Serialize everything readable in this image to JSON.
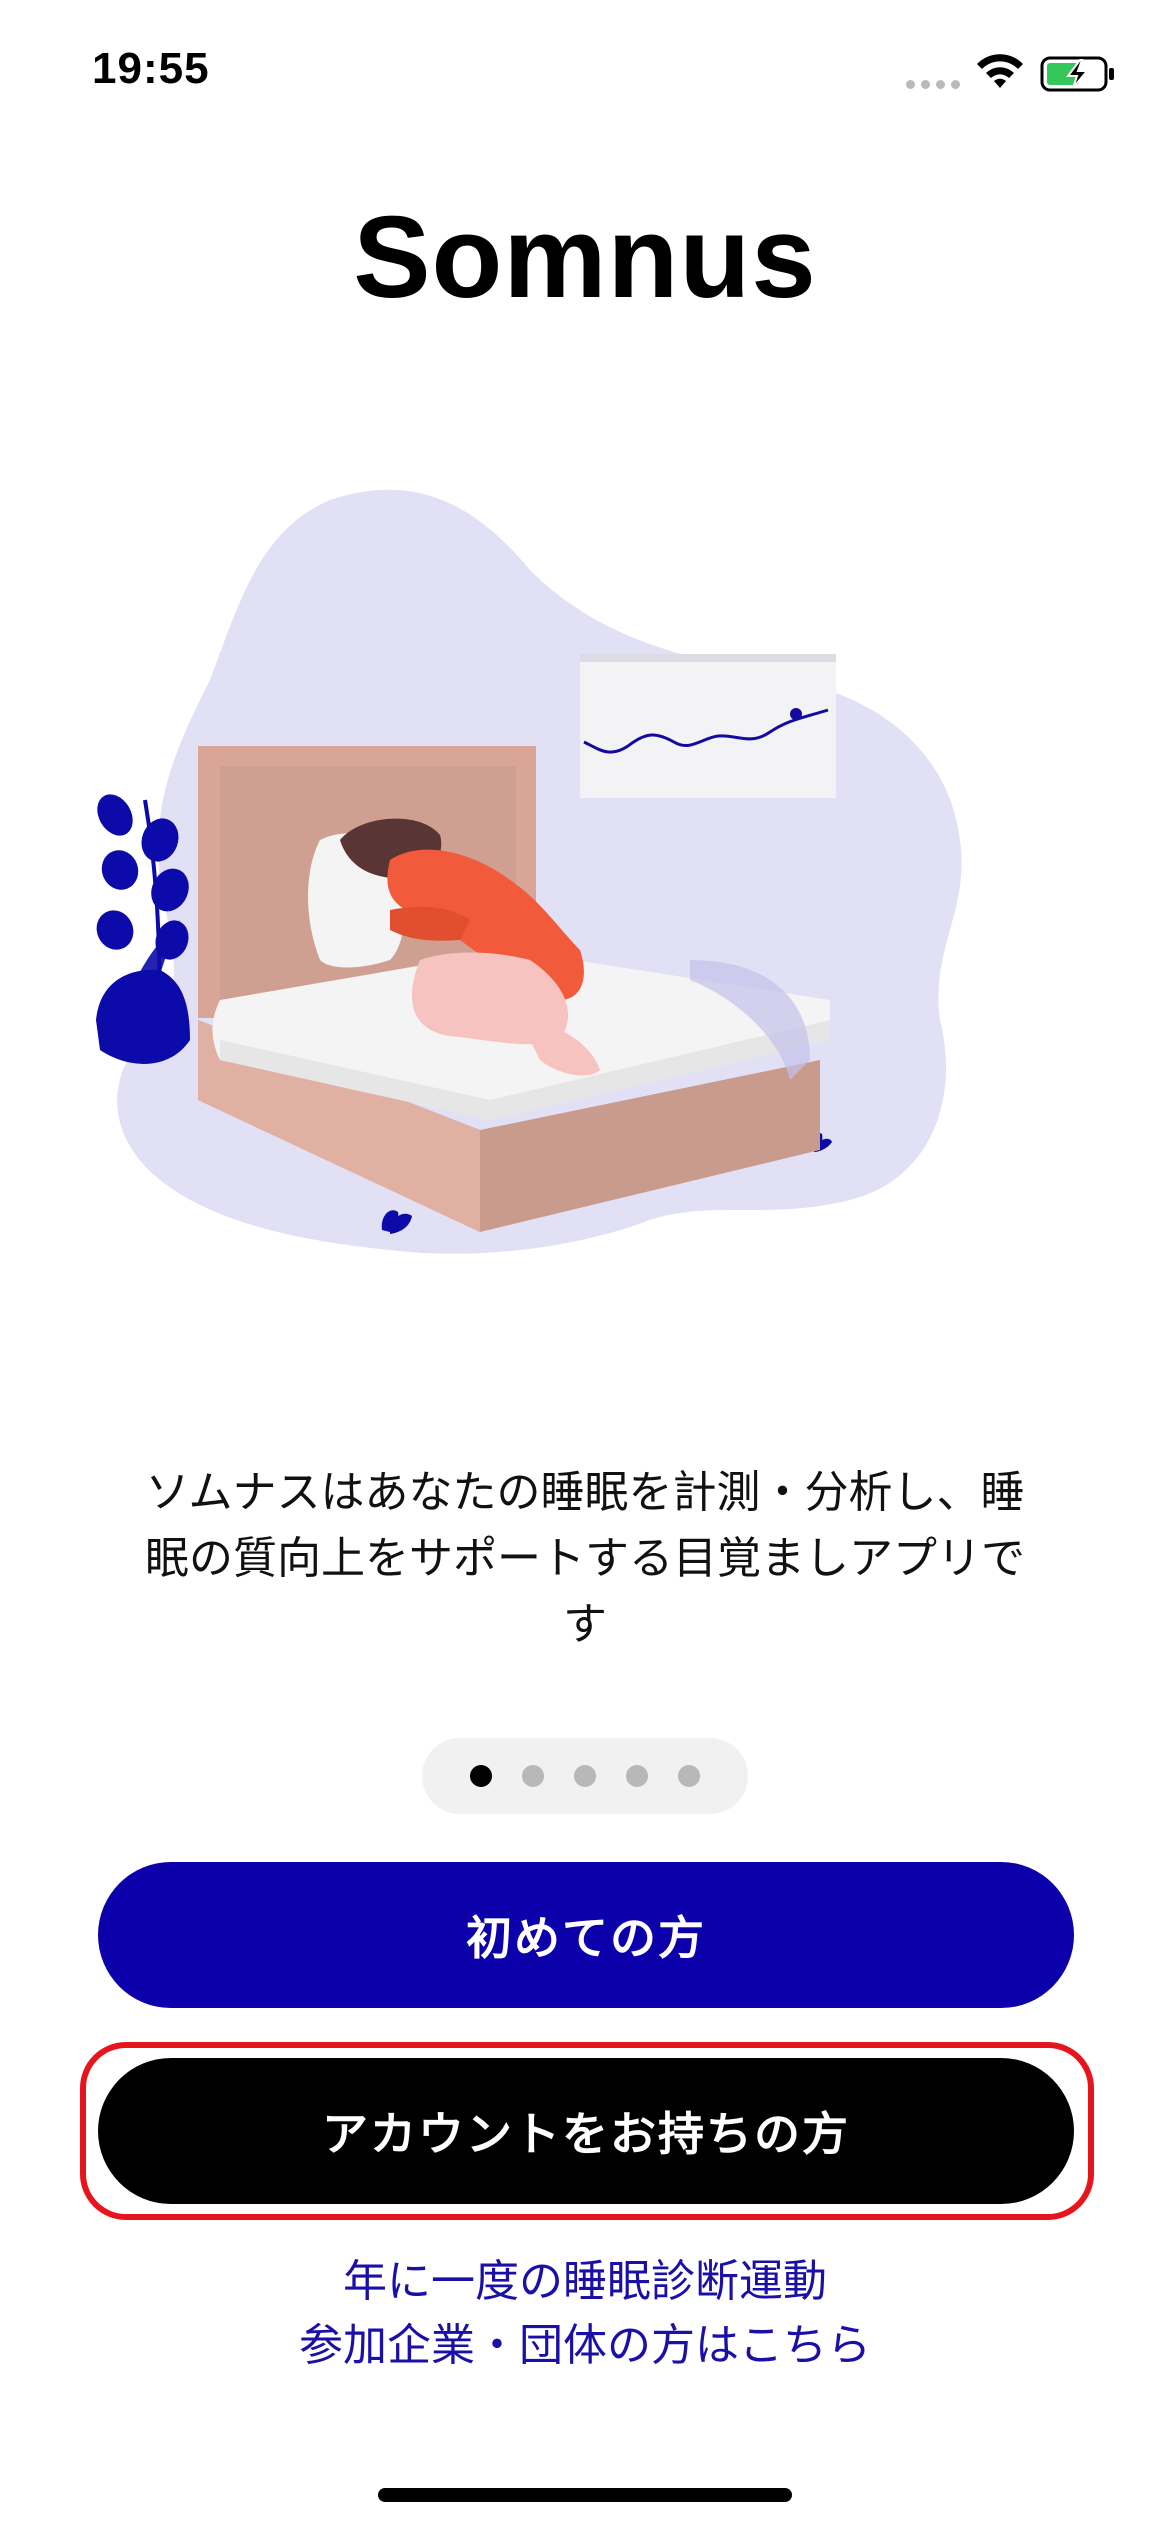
{
  "status_bar": {
    "time": "19:55",
    "icons": [
      "signal-dots-icon",
      "wifi-icon",
      "battery-charging-icon"
    ],
    "battery_color": "#34c759"
  },
  "app": {
    "title": "Somnus"
  },
  "onboarding": {
    "illustration": "woman-sleeping-on-bed-illustration",
    "description_lines": [
      "ソムナスはあなたの睡眠を計測・分析し、睡",
      "眠の質向上をサポートする目覚ましアプリで",
      "す"
    ],
    "page_count": 5,
    "current_page": 1
  },
  "buttons": {
    "new_user_label": "初めての方",
    "existing_account_label": "アカウントをお持ちの方"
  },
  "link": {
    "line1": "年に一度の睡眠診断運動",
    "line2": "参加企業・団体の方はこちら"
  },
  "colors": {
    "primary": "#0c00aa",
    "dark_button": "#000000",
    "highlight": "#e8141b",
    "link": "#1a10a8",
    "blob": "#e2e0f5"
  }
}
